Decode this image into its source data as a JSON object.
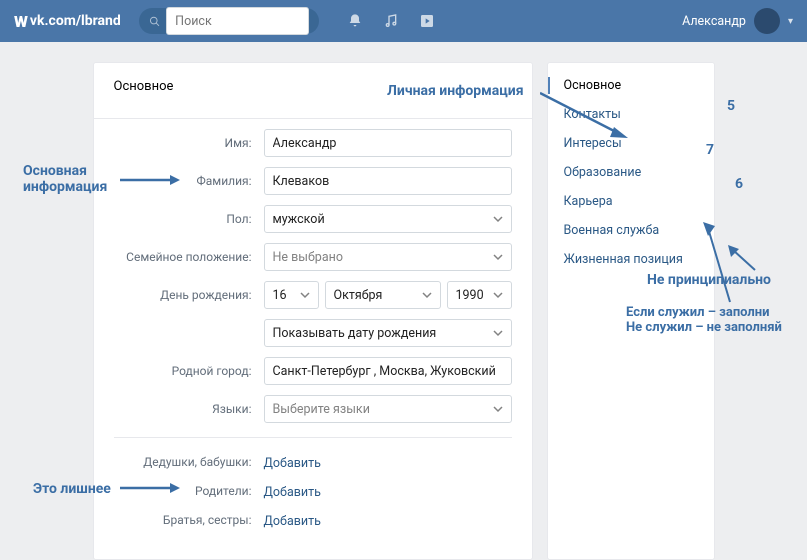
{
  "header": {
    "url": "vk.com/lbrand",
    "search_placeholder": "Поиск",
    "username": "Александр"
  },
  "main": {
    "heading": "Основное",
    "labels": {
      "name": "Имя:",
      "surname": "Фамилия:",
      "gender": "Пол:",
      "marital": "Семейное положение:",
      "birthday": "День рождения:",
      "hometown": "Родной город:",
      "languages": "Языки:",
      "grandparents": "Дедушки, бабушки:",
      "parents": "Родители:",
      "siblings": "Братья, сестры:"
    },
    "values": {
      "name": "Александр",
      "surname": "Клеваков",
      "gender": "мужской",
      "marital": "Не выбрано",
      "bday_day": "16",
      "bday_month": "Октября",
      "bday_year": "1990",
      "bday_visibility": "Показывать дату рождения",
      "hometown": "Санкт-Петербург , Москва, Жуковский",
      "languages": "Выберите языки",
      "add_link": "Добавить"
    }
  },
  "sidebar": {
    "items": [
      {
        "label": "Основное",
        "active": true
      },
      {
        "label": "Контакты"
      },
      {
        "label": "Интересы"
      },
      {
        "label": "Образование"
      },
      {
        "label": "Карьера"
      },
      {
        "label": "Военная служба"
      },
      {
        "label": "Жизненная позиция"
      }
    ]
  },
  "annotations": {
    "personal_info": "Личная информация",
    "basic_info_l1": "Основная",
    "basic_info_l2": "информация",
    "extra": "Это лишнее",
    "not_important": "Не принципиально",
    "served_l1": "Если служил – заполни",
    "served_l2": "Не служил – не заполняй",
    "n5": "5",
    "n6": "6",
    "n7": "7"
  }
}
